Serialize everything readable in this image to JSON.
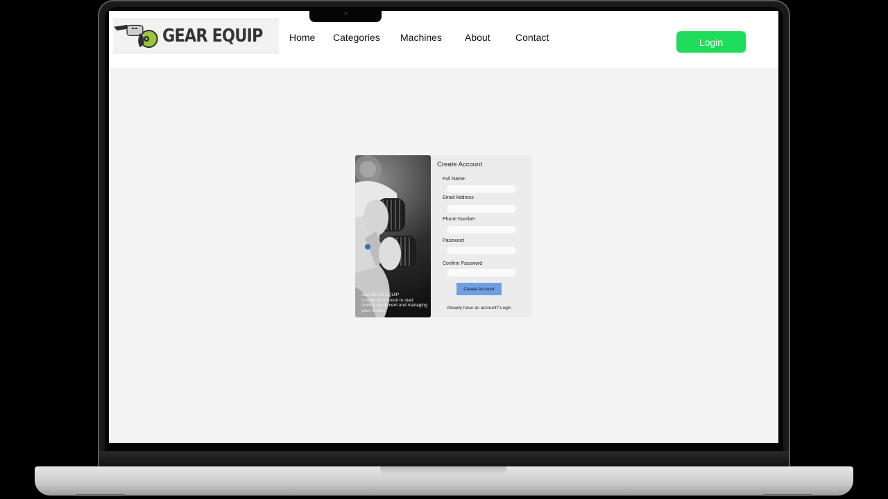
{
  "brand": {
    "name": "GEAR EQUIP"
  },
  "nav": {
    "items": [
      {
        "label": "Home"
      },
      {
        "label": "Categories"
      },
      {
        "label": "Machines"
      },
      {
        "label": "About"
      },
      {
        "label": "Contact"
      }
    ],
    "login_label": "Login"
  },
  "signup": {
    "image_caption": {
      "title": "Join GEAR EQUIP",
      "text": "Create an account to start renting equipment and managing your rentals."
    },
    "title": "Create Account",
    "fields": [
      {
        "label": "Full Name",
        "value": ""
      },
      {
        "label": "Email Address",
        "value": ""
      },
      {
        "label": "Phone Number",
        "value": ""
      },
      {
        "label": "Password",
        "value": ""
      },
      {
        "label": "Confirm Password",
        "value": ""
      }
    ],
    "submit_label": "Create Account",
    "login_prompt": "Already have an account?",
    "login_link": "Login"
  },
  "colors": {
    "login_button": "#1fdd5a",
    "submit_button": "#6f9fe3",
    "page_background": "#f4f4f4",
    "logo_accent": "#9bc53d"
  }
}
